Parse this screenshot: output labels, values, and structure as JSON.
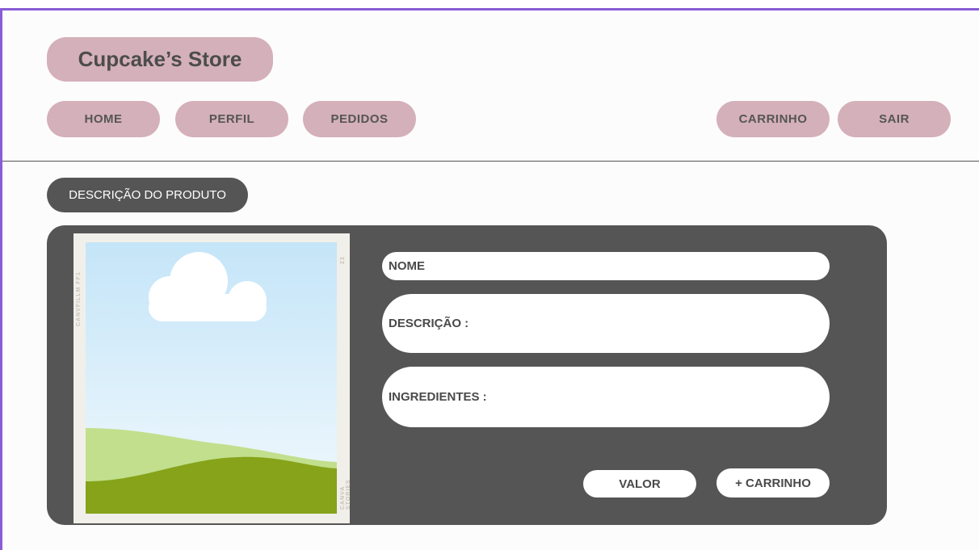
{
  "header": {
    "store_name": "Cupcake’s Store",
    "nav_left": [
      "HOME",
      "PERFIL",
      "PEDIDOS"
    ],
    "nav_right": [
      "CARRINHO",
      "SAIR"
    ]
  },
  "section": {
    "title": "DESCRIÇÃO DO PRODUTO"
  },
  "product": {
    "image_icon": "placeholder-landscape-image",
    "film_labels": [
      "CANVFILLM FF1",
      "23",
      "CANVA STORIES"
    ],
    "name_label": "NOME",
    "description_label": "DESCRIÇÃO :",
    "ingredients_label": "INGREDIENTES :",
    "value_label": "VALOR",
    "add_to_cart_label": "+ CARRINHO"
  },
  "colors": {
    "accent_border": "#8a5cd6",
    "pill_pink": "#d4b0ba",
    "dark_panel": "#555555"
  }
}
